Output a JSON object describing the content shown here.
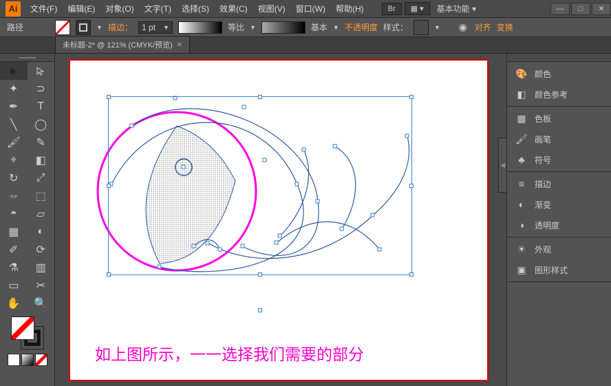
{
  "app": {
    "logo": "Ai"
  },
  "menu": {
    "items": [
      "文件(F)",
      "编辑(E)",
      "对象(O)",
      "文字(T)",
      "选择(S)",
      "效果(C)",
      "视图(V)",
      "窗口(W)",
      "帮助(H)"
    ]
  },
  "titlebar": {
    "br": "Br",
    "workspace": "基本功能"
  },
  "options": {
    "label_path": "路径",
    "stroke_label": "描边：",
    "stroke_weight": "1 pt",
    "profile": "等比",
    "brush": "基本",
    "opacity_label": "不透明度",
    "style_label": "样式：",
    "align_label": "对齐",
    "transform_label": "变换"
  },
  "tab": {
    "title": "未标题-2* @ 121% (CMYK/预览)"
  },
  "canvas": {
    "caption": "如上图所示，一一选择我们需要的部分"
  },
  "panels": {
    "g1": [
      {
        "icon": "palette",
        "label": "颜色"
      },
      {
        "icon": "guide",
        "label": "颜色参考"
      }
    ],
    "g2": [
      {
        "icon": "swatch",
        "label": "色板"
      },
      {
        "icon": "brush",
        "label": "画笔"
      },
      {
        "icon": "symbol",
        "label": "符号"
      }
    ],
    "g3": [
      {
        "icon": "stroke",
        "label": "描边"
      },
      {
        "icon": "grad",
        "label": "渐变"
      },
      {
        "icon": "trans",
        "label": "透明度"
      }
    ],
    "g4": [
      {
        "icon": "appear",
        "label": "外观"
      },
      {
        "icon": "gstyle",
        "label": "图形样式"
      }
    ]
  }
}
